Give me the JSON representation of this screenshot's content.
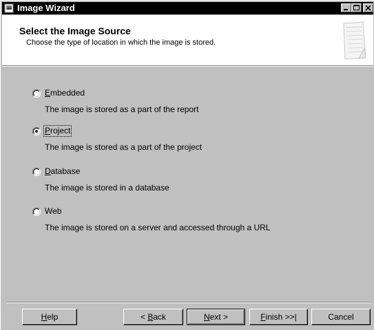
{
  "window": {
    "title": "Image Wizard",
    "title_icon": "wizard-app-icon"
  },
  "header": {
    "title": "Select the Image Source",
    "subtitle": "Choose the type of location in which the image is stored."
  },
  "options": [
    {
      "key": "embedded",
      "access_key": "E",
      "label_rest": "mbedded",
      "label": "Embedded",
      "description": "The image is stored as a part of the report",
      "selected": false
    },
    {
      "key": "project",
      "access_key": "P",
      "label_rest": "roject",
      "label": "Project",
      "description": "The image is stored as a part of the project",
      "selected": true
    },
    {
      "key": "database",
      "access_key": "D",
      "label_rest": "atabase",
      "label": "Database",
      "description": "The image is stored in a database",
      "selected": false
    },
    {
      "key": "web",
      "access_key": "",
      "label_rest": "Web",
      "label": "Web",
      "description": "The image is stored on a server and accessed through a URL",
      "selected": false
    }
  ],
  "buttons": {
    "help": {
      "access_key": "H",
      "rest": "elp"
    },
    "back": {
      "prefix": "< ",
      "access_key": "B",
      "rest": "ack"
    },
    "next": {
      "access_key": "N",
      "rest": "ext >"
    },
    "finish": {
      "access_key": "F",
      "rest": "inish >>|"
    },
    "cancel": {
      "label": "Cancel"
    }
  },
  "colors": {
    "face": "#c0c0c0",
    "title_bar": "#000000",
    "header_bg": "#ffffff"
  }
}
